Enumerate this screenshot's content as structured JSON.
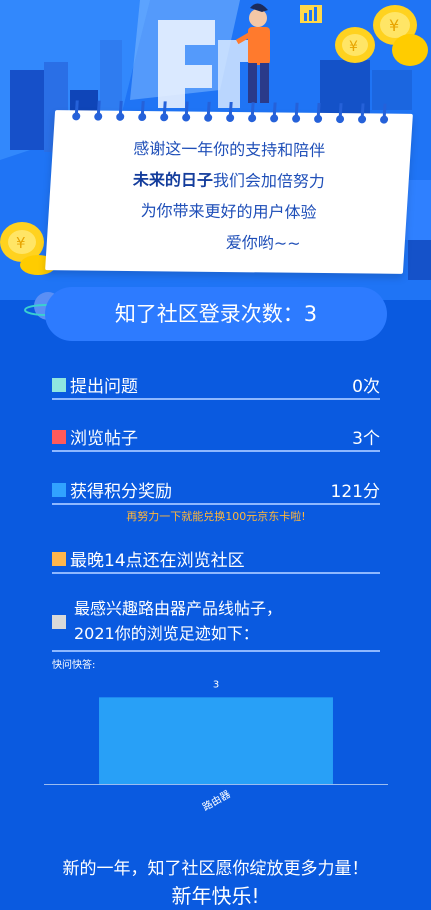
{
  "calendar": {
    "line1": "感谢这一年你的支持和陪伴",
    "line2_bold": "未来的日子",
    "line2_rest": "我们会加倍努力",
    "line3": "为你带来更好的用户体验",
    "line4": "爱你哟~~"
  },
  "login": {
    "text": "知了社区登录次数：3"
  },
  "stats": [
    {
      "label": "提出问题",
      "value": "0次",
      "color": "#8fe6e0"
    },
    {
      "label": "浏览帖子",
      "value": "3个",
      "color": "#ff5a5a"
    },
    {
      "label": "获得积分奖励",
      "value": "121分",
      "color": "#31a2ff"
    },
    {
      "label": "最晚14点还在浏览社区",
      "value": "",
      "color": "#ffb64d"
    }
  ],
  "hint": "再努力一下就能兑换100元京东卡啦!",
  "interest": {
    "line1": "最感兴趣路由器产品线帖子，",
    "line2": "2021你的浏览足迹如下：",
    "color": "#d9d9d9"
  },
  "chart_data": {
    "type": "bar",
    "title": "快问快答:",
    "categories": [
      "路由器"
    ],
    "values": [
      3
    ],
    "ylim": [
      0,
      3.6
    ],
    "bar_color": "#28a0f7",
    "data_labels": true
  },
  "footer": {
    "line1": "新的一年，知了社区愿你绽放更多力量！",
    "line2": "新年快乐!"
  }
}
